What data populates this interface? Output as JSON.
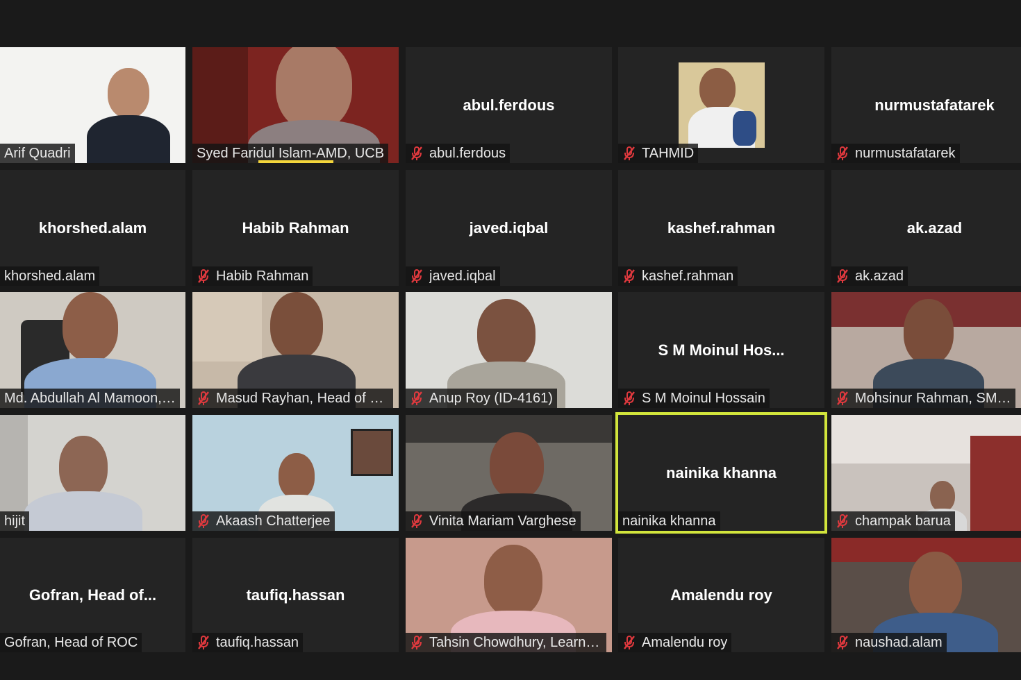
{
  "colors": {
    "background": "#1a1a1a",
    "tile": "#242424",
    "active_speaker_border": "#d2e53c",
    "muted_icon": "#e0393e"
  },
  "tiles": [
    {
      "id": "t1",
      "name": "Arif Quadri",
      "video": true,
      "muted": false
    },
    {
      "id": "t2",
      "name": "Syed Faridul Islam-AMD, UCB",
      "video": true,
      "muted": false
    },
    {
      "id": "t3",
      "name": "abul.ferdous",
      "display": "abul.ferdous",
      "video": false,
      "muted": true
    },
    {
      "id": "t4",
      "name": "TAHMID",
      "video": "photo",
      "muted": true
    },
    {
      "id": "t5",
      "name": "nurmustafatarek",
      "display": "nurmustafatarek",
      "video": false,
      "muted": true
    },
    {
      "id": "t6",
      "name": "khorshed.alam",
      "display": "khorshed.alam",
      "video": false,
      "muted": false
    },
    {
      "id": "t7",
      "name": "Habib Rahman",
      "display": "Habib Rahman",
      "video": false,
      "muted": true
    },
    {
      "id": "t8",
      "name": "javed.iqbal",
      "display": "javed.iqbal",
      "video": false,
      "muted": true
    },
    {
      "id": "t9",
      "name": "kashef.rahman",
      "display": "kashef.rahman",
      "video": false,
      "muted": true
    },
    {
      "id": "t10",
      "name": "ak.azad",
      "display": "ak.azad",
      "video": false,
      "muted": true
    },
    {
      "id": "t11",
      "name": "Md. Abdullah Al Mamoon, ...",
      "video": true,
      "muted": false
    },
    {
      "id": "t12",
      "name": "Masud Rayhan, Head of LDC",
      "video": true,
      "muted": true
    },
    {
      "id": "t13",
      "name": "Anup Roy (ID-4161)",
      "video": true,
      "muted": true
    },
    {
      "id": "t14",
      "name": "S M Moinul Hossain",
      "display": "S M Moinul Hos...",
      "video": false,
      "muted": true
    },
    {
      "id": "t15",
      "name": "Mohsinur Rahman, SME Ba",
      "video": true,
      "muted": true
    },
    {
      "id": "t16",
      "name": "hijit",
      "video": true,
      "muted": false
    },
    {
      "id": "t17",
      "name": "Akaash Chatterjee",
      "video": true,
      "muted": true
    },
    {
      "id": "t18",
      "name": "Vinita Mariam Varghese",
      "video": true,
      "muted": true
    },
    {
      "id": "t19",
      "name": "nainika khanna",
      "display": "nainika khanna",
      "video": false,
      "muted": false,
      "speaking": true
    },
    {
      "id": "t20",
      "name": "champak barua",
      "video": true,
      "muted": true
    },
    {
      "id": "t21",
      "name": "Gofran, Head of ROC",
      "display": "Gofran, Head of...",
      "video": false,
      "muted": false
    },
    {
      "id": "t22",
      "name": "taufiq.hassan",
      "display": "taufiq.hassan",
      "video": false,
      "muted": true
    },
    {
      "id": "t23",
      "name": "Tahsin Chowdhury, Learnin...",
      "video": true,
      "muted": true
    },
    {
      "id": "t24",
      "name": "Amalendu roy",
      "display": "Amalendu roy",
      "video": false,
      "muted": true
    },
    {
      "id": "t25",
      "name": "naushad.alam",
      "video": true,
      "muted": true
    }
  ]
}
